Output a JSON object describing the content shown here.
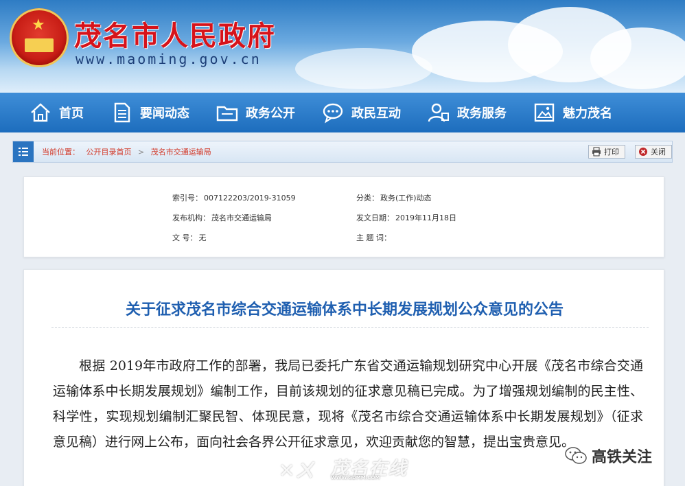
{
  "header": {
    "site_title": "茂名市人民政府",
    "site_url": "www.maoming.gov.cn"
  },
  "nav": {
    "items": [
      {
        "label": "首页",
        "icon": "home-icon"
      },
      {
        "label": "要闻动态",
        "icon": "document-icon"
      },
      {
        "label": "政务公开",
        "icon": "folder-icon"
      },
      {
        "label": "政民互动",
        "icon": "chat-icon"
      },
      {
        "label": "政务服务",
        "icon": "user-service-icon"
      },
      {
        "label": "魅力茂名",
        "icon": "picture-icon"
      }
    ]
  },
  "breadcrumb": {
    "prefix": "当前位置：",
    "items": [
      "公开目录首页",
      "茂名市交通运输局"
    ],
    "separator": ">",
    "print_label": "打印",
    "close_label": "关闭"
  },
  "meta": {
    "index_label": "索引号：",
    "index_value": "007122203/2019-31059",
    "category_label": "分类：",
    "category_value": "政务(工作)动态",
    "publisher_label": "发布机构：",
    "publisher_value": "茂名市交通运输局",
    "date_label": "发文日期：",
    "date_value": "2019年11月18日",
    "docno_label": "文 号：",
    "docno_value": "无",
    "subject_label": "主 题 词：",
    "subject_value": ""
  },
  "article": {
    "title": "关于征求茂名市综合交通运输体系中长期发展规划公众意见的公告",
    "body": "根据 2019年市政府工作的部署，我局已委托广东省交通运输规划研究中心开展《茂名市综合交通运输体系中长期发展规划》编制工作，目前该规划的征求意见稿已完成。为了增强规划编制的民主性、科学性，实现规划编制汇聚民智、体现民意，现将《茂名市综合交通运输体系中长期发展规划》（征求意见稿）进行网上公布，面向社会各界公开征求意见，欢迎贡献您的智慧，提出宝贵意见。"
  },
  "watermarks": {
    "center_main": "茂名在线",
    "center_sub": "WWW.GDMM.COM",
    "right_text": "高铁关注"
  },
  "colors": {
    "nav_blue": "#1d6dbd",
    "title_red": "#d6131b",
    "article_title_blue": "#1f5fb0"
  }
}
